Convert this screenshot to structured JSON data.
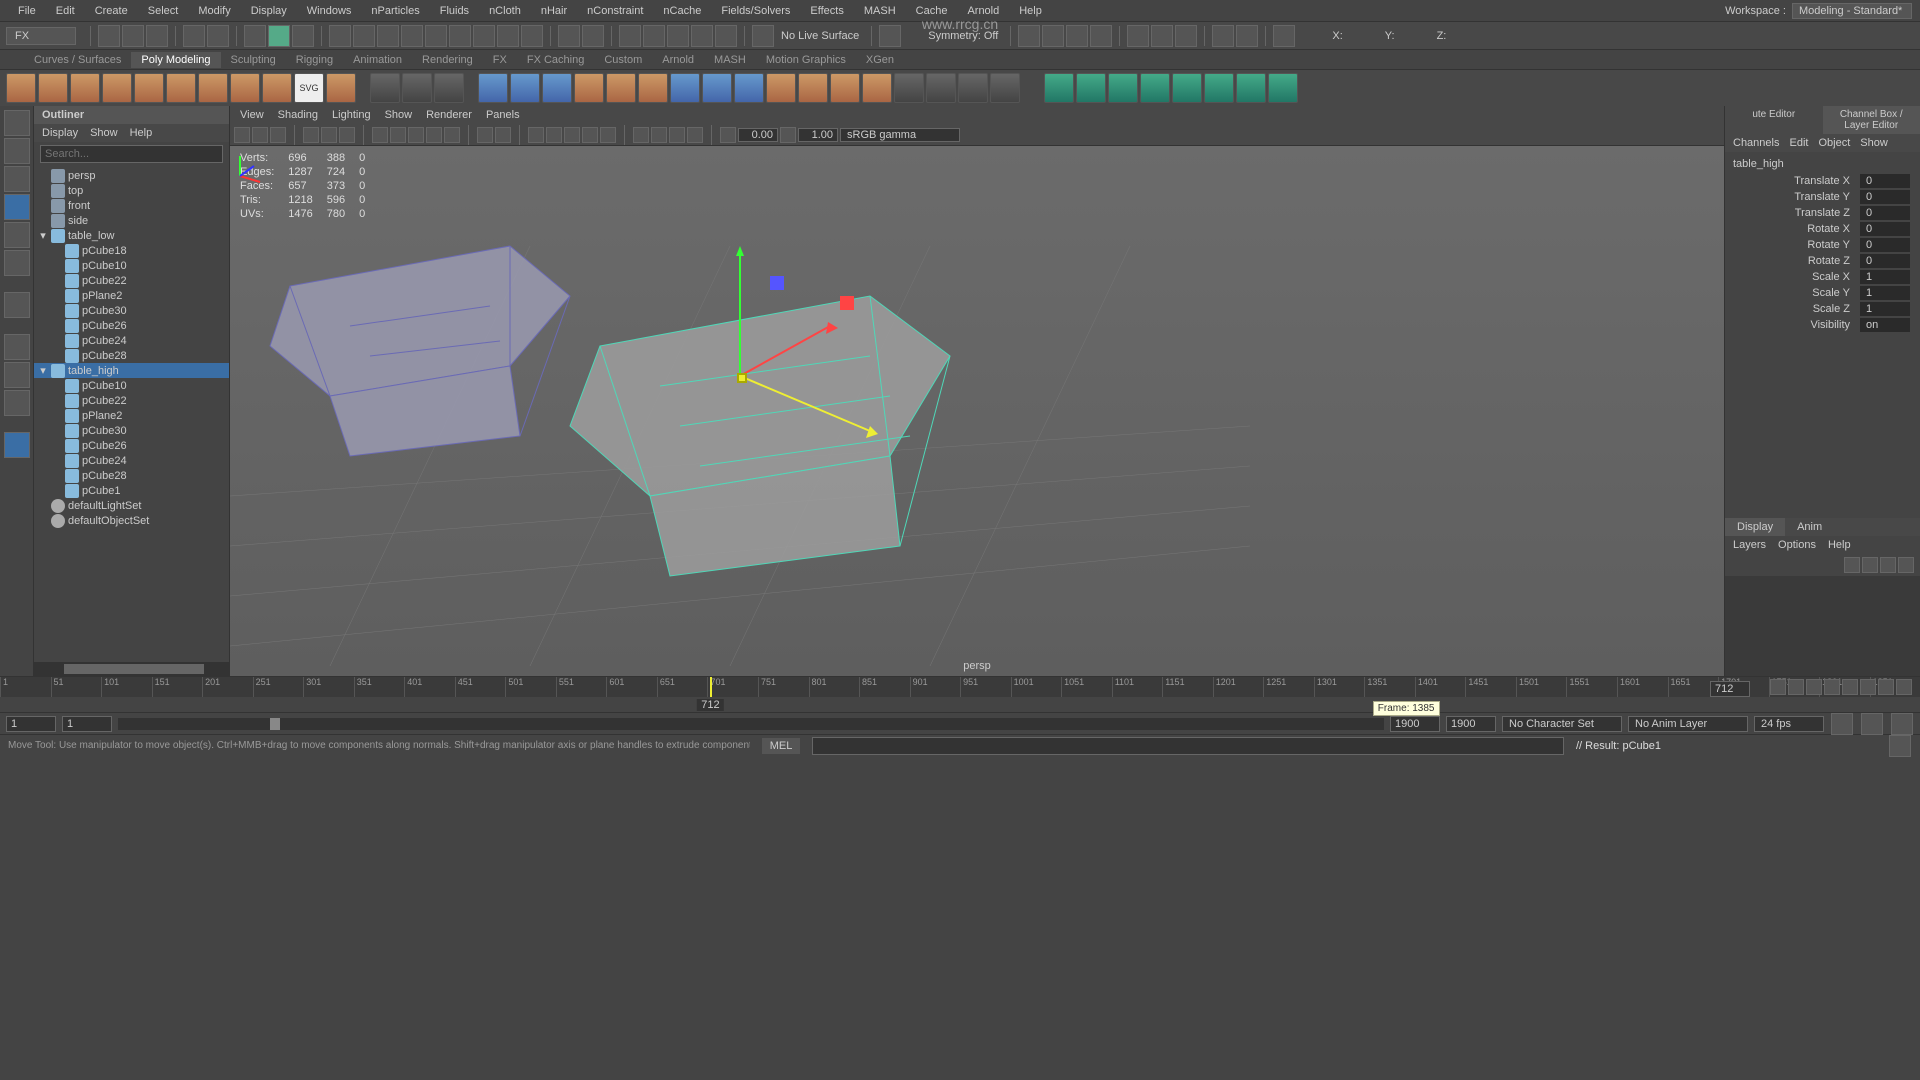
{
  "watermark_url": "www.rrcg.cn",
  "menu": [
    "File",
    "Edit",
    "Create",
    "Select",
    "Modify",
    "Display",
    "Windows",
    "nParticles",
    "Fluids",
    "nCloth",
    "nHair",
    "nConstraint",
    "nCache",
    "Fields/Solvers",
    "Effects",
    "MASH",
    "Cache",
    "Arnold",
    "Help"
  ],
  "workspace": {
    "label": "Workspace :",
    "value": "Modeling - Standard*"
  },
  "module_dropdown": "FX",
  "no_live": "No Live Surface",
  "symmetry": "Symmetry: Off",
  "axes": {
    "x": "X:",
    "y": "Y:",
    "z": "Z:"
  },
  "shelf_tabs": [
    "Curves / Surfaces",
    "Poly Modeling",
    "Sculpting",
    "Rigging",
    "Animation",
    "Rendering",
    "FX",
    "FX Caching",
    "Custom",
    "Arnold",
    "MASH",
    "Motion Graphics",
    "XGen"
  ],
  "shelf_active": 1,
  "outliner": {
    "title": "Outliner",
    "menu": [
      "Display",
      "Show",
      "Help"
    ],
    "search_placeholder": "Search...",
    "nodes": [
      {
        "label": "persp",
        "icon": "cam",
        "dim": true,
        "depth": 0
      },
      {
        "label": "top",
        "icon": "cam",
        "dim": true,
        "depth": 0
      },
      {
        "label": "front",
        "icon": "cam",
        "dim": true,
        "depth": 0
      },
      {
        "label": "side",
        "icon": "cam",
        "dim": true,
        "depth": 0
      },
      {
        "label": "table_low",
        "icon": "mesh",
        "depth": 0,
        "expanded": true
      },
      {
        "label": "pCube18",
        "icon": "mesh",
        "depth": 1
      },
      {
        "label": "pCube10",
        "icon": "mesh",
        "depth": 1
      },
      {
        "label": "pCube22",
        "icon": "mesh",
        "depth": 1
      },
      {
        "label": "pPlane2",
        "icon": "mesh",
        "depth": 1
      },
      {
        "label": "pCube30",
        "icon": "mesh",
        "depth": 1
      },
      {
        "label": "pCube26",
        "icon": "mesh",
        "depth": 1
      },
      {
        "label": "pCube24",
        "icon": "mesh",
        "depth": 1
      },
      {
        "label": "pCube28",
        "icon": "mesh",
        "depth": 1
      },
      {
        "label": "table_high",
        "icon": "mesh",
        "depth": 0,
        "expanded": true,
        "selected": true
      },
      {
        "label": "pCube10",
        "icon": "mesh",
        "depth": 1
      },
      {
        "label": "pCube22",
        "icon": "mesh",
        "depth": 1
      },
      {
        "label": "pPlane2",
        "icon": "mesh",
        "depth": 1
      },
      {
        "label": "pCube30",
        "icon": "mesh",
        "depth": 1
      },
      {
        "label": "pCube26",
        "icon": "mesh",
        "depth": 1
      },
      {
        "label": "pCube24",
        "icon": "mesh",
        "depth": 1
      },
      {
        "label": "pCube28",
        "icon": "mesh",
        "depth": 1
      },
      {
        "label": "pCube1",
        "icon": "mesh",
        "depth": 1
      },
      {
        "label": "defaultLightSet",
        "icon": "set",
        "depth": 0
      },
      {
        "label": "defaultObjectSet",
        "icon": "set",
        "depth": 0
      }
    ]
  },
  "viewport": {
    "menu": [
      "View",
      "Shading",
      "Lighting",
      "Show",
      "Renderer",
      "Panels"
    ],
    "num1": "0.00",
    "num2": "1.00",
    "colorspace": "sRGB gamma",
    "persp": "persp"
  },
  "polycount": {
    "rows": [
      [
        "Verts:",
        "696",
        "388",
        "0"
      ],
      [
        "Edges:",
        "1287",
        "724",
        "0"
      ],
      [
        "Faces:",
        "657",
        "373",
        "0"
      ],
      [
        "Tris:",
        "1218",
        "596",
        "0"
      ],
      [
        "UVs:",
        "1476",
        "780",
        "0"
      ]
    ]
  },
  "channel_box": {
    "tabs": [
      "ute Editor",
      "Channel Box / Layer Editor"
    ],
    "menu": [
      "Channels",
      "Edit",
      "Object",
      "Show"
    ],
    "object": "table_high",
    "attrs": [
      [
        "Translate X",
        "0"
      ],
      [
        "Translate Y",
        "0"
      ],
      [
        "Translate Z",
        "0"
      ],
      [
        "Rotate X",
        "0"
      ],
      [
        "Rotate Y",
        "0"
      ],
      [
        "Rotate Z",
        "0"
      ],
      [
        "Scale X",
        "1"
      ],
      [
        "Scale Y",
        "1"
      ],
      [
        "Scale Z",
        "1"
      ],
      [
        "Visibility",
        "on"
      ]
    ]
  },
  "layers": {
    "tabs": [
      "Display",
      "Anim"
    ],
    "menu": [
      "Layers",
      "Options",
      "Help"
    ]
  },
  "timeline": {
    "start": 1,
    "end": 1900,
    "current": 712,
    "tooltip": "Frame: 1385",
    "box": "712"
  },
  "range": {
    "start1": "1",
    "start2": "1",
    "end1": "1900",
    "end2": "1900",
    "charset": "No Character Set",
    "animlayer": "No Anim Layer",
    "fps": "24 fps"
  },
  "status": {
    "help": "Move Tool: Use manipulator to move object(s). Ctrl+MMB+drag to move components along normals. Shift+drag manipulator axis or plane handles to extrude components or clone objects. Ctrl+Shift+LMB+drag t",
    "lang": "MEL",
    "result": "// Result: pCube1"
  }
}
